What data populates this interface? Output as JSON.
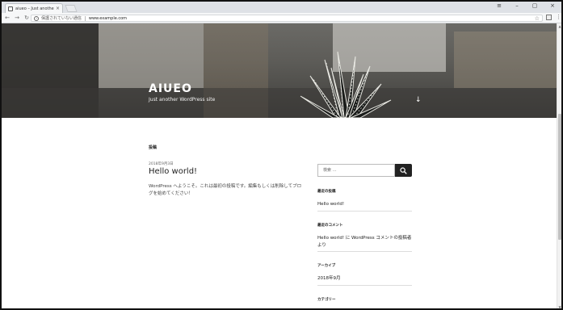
{
  "browser": {
    "tab_title": "aiueo – Just another Wo",
    "tab_close": "×",
    "window_controls": [
      "≡",
      "–",
      "▢",
      "×"
    ],
    "nav": {
      "back": "←",
      "forward": "→",
      "reload": "↻"
    },
    "security_label": "保護されていない通信",
    "url": "www.example.com",
    "star": "☆",
    "menu": "⋮"
  },
  "site": {
    "title": "AIUEO",
    "tagline": "Just another WordPress site",
    "scroll_arrow": "↓"
  },
  "main": {
    "page_label": "投稿",
    "post": {
      "date": "2018年9月3日",
      "title": "Hello world!",
      "body": "WordPress へようこそ。これは最初の投稿です。編集もしくは削除してブログを始めてください！"
    }
  },
  "sidebar": {
    "search_placeholder": "検索 …",
    "widgets": {
      "recent_posts_title": "最近の投稿",
      "recent_post_link": "Hello world!",
      "recent_comments_title": "最近のコメント",
      "recent_comment_text": "Hello world! に WordPress コメントの投稿者 より",
      "archives_title": "アーカイブ",
      "archive_link": "2018年9月",
      "categories_title": "カテゴリー"
    }
  },
  "colors": {
    "chrome_bg": "#dee1e6",
    "text": "#222222",
    "search_button": "#222222",
    "hero_text": "#ffffff"
  }
}
